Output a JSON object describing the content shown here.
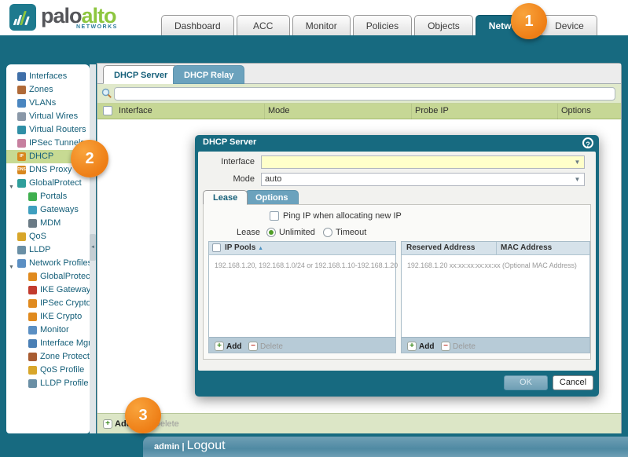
{
  "brand": {
    "word1": "palo",
    "word2": "alto",
    "networks": "NETWORKS"
  },
  "top_tabs": [
    {
      "label": "Dashboard",
      "active": false
    },
    {
      "label": "ACC",
      "active": false
    },
    {
      "label": "Monitor",
      "active": false
    },
    {
      "label": "Policies",
      "active": false
    },
    {
      "label": "Objects",
      "active": false
    },
    {
      "label": "Network",
      "active": true
    },
    {
      "label": "Device",
      "active": false
    }
  ],
  "sidebar": {
    "items": [
      {
        "label": "Interfaces",
        "icon": "interfaces-icon",
        "color": "#3f6fa8",
        "glyph": "",
        "indent": false,
        "expander": false,
        "selected": false
      },
      {
        "label": "Zones",
        "icon": "zones-icon",
        "color": "#b06a38",
        "glyph": "",
        "indent": false,
        "expander": false,
        "selected": false
      },
      {
        "label": "VLANs",
        "icon": "vlans-icon",
        "color": "#4a86c0",
        "glyph": "",
        "indent": false,
        "expander": false,
        "selected": false
      },
      {
        "label": "Virtual Wires",
        "icon": "virtual-wires-icon",
        "color": "#8a98a8",
        "glyph": "",
        "indent": false,
        "expander": false,
        "selected": false
      },
      {
        "label": "Virtual Routers",
        "icon": "virtual-routers-icon",
        "color": "#2f8fa6",
        "glyph": "",
        "indent": false,
        "expander": false,
        "selected": false
      },
      {
        "label": "IPSec Tunnels",
        "icon": "ipsec-tunnels-icon",
        "color": "#c77f9f",
        "glyph": "",
        "indent": false,
        "expander": false,
        "selected": false
      },
      {
        "label": "DHCP",
        "icon": "dhcp-icon",
        "color": "#d8871e",
        "glyph": "IP",
        "indent": false,
        "expander": false,
        "selected": true
      },
      {
        "label": "DNS Proxy",
        "icon": "dns-proxy-icon",
        "color": "#d8871e",
        "glyph": "DNS",
        "indent": false,
        "expander": false,
        "selected": false
      },
      {
        "label": "GlobalProtect",
        "icon": "globalprotect-icon",
        "color": "#2f9e9b",
        "glyph": "",
        "indent": false,
        "expander": true,
        "selected": false
      },
      {
        "label": "Portals",
        "icon": "portals-icon",
        "color": "#3faf4f",
        "glyph": "",
        "indent": true,
        "expander": false,
        "selected": false
      },
      {
        "label": "Gateways",
        "icon": "gateways-icon",
        "color": "#3f9fbf",
        "glyph": "",
        "indent": true,
        "expander": false,
        "selected": false
      },
      {
        "label": "MDM",
        "icon": "mdm-icon",
        "color": "#6a7a85",
        "glyph": "",
        "indent": true,
        "expander": false,
        "selected": false
      },
      {
        "label": "QoS",
        "icon": "qos-icon",
        "color": "#d8a62a",
        "glyph": "",
        "indent": false,
        "expander": false,
        "selected": false
      },
      {
        "label": "LLDP",
        "icon": "lldp-icon",
        "color": "#6a8fa5",
        "glyph": "",
        "indent": false,
        "expander": false,
        "selected": false
      },
      {
        "label": "Network Profiles",
        "icon": "network-profiles-icon",
        "color": "#5b8fc3",
        "glyph": "",
        "indent": false,
        "expander": true,
        "selected": false
      },
      {
        "label": "GlobalProtect IP",
        "icon": "lock-icon",
        "color": "#e08a1e",
        "glyph": "",
        "indent": true,
        "expander": false,
        "selected": false
      },
      {
        "label": "IKE Gateways",
        "icon": "ike-gateways-icon",
        "color": "#c23b2e",
        "glyph": "",
        "indent": true,
        "expander": false,
        "selected": false
      },
      {
        "label": "IPSec Crypto",
        "icon": "lock-icon",
        "color": "#e08a1e",
        "glyph": "",
        "indent": true,
        "expander": false,
        "selected": false
      },
      {
        "label": "IKE Crypto",
        "icon": "lock-icon",
        "color": "#e08a1e",
        "glyph": "",
        "indent": true,
        "expander": false,
        "selected": false
      },
      {
        "label": "Monitor",
        "icon": "monitor-icon",
        "color": "#5b8fc3",
        "glyph": "",
        "indent": true,
        "expander": false,
        "selected": false
      },
      {
        "label": "Interface Mgmt",
        "icon": "interface-mgmt-icon",
        "color": "#4a7fb5",
        "glyph": "",
        "indent": true,
        "expander": false,
        "selected": false
      },
      {
        "label": "Zone Protection",
        "icon": "zone-protection-icon",
        "color": "#a85c32",
        "glyph": "",
        "indent": true,
        "expander": false,
        "selected": false
      },
      {
        "label": "QoS Profile",
        "icon": "qos-profile-icon",
        "color": "#d8a62a",
        "glyph": "",
        "indent": true,
        "expander": false,
        "selected": false
      },
      {
        "label": "LLDP Profile",
        "icon": "lldp-profile-icon",
        "color": "#6a8fa5",
        "glyph": "",
        "indent": true,
        "expander": false,
        "selected": false
      }
    ]
  },
  "main": {
    "tabs": [
      {
        "label": "DHCP Server",
        "active": true
      },
      {
        "label": "DHCP Relay",
        "active": false
      }
    ],
    "search_value": "",
    "columns": [
      "Interface",
      "Mode",
      "Probe IP",
      "Options"
    ],
    "add_label": "Add",
    "delete_label": "Delete"
  },
  "dialog": {
    "title": "DHCP Server",
    "help": "?",
    "interface_label": "Interface",
    "interface_value": "",
    "mode_label": "Mode",
    "mode_value": "auto",
    "tabs": [
      {
        "label": "Lease",
        "active": true
      },
      {
        "label": "Options",
        "active": false
      }
    ],
    "ping_label": "Ping IP when allocating new IP",
    "lease_label": "Lease",
    "lease_options": [
      {
        "label": "Unlimited",
        "selected": true
      },
      {
        "label": "Timeout",
        "selected": false
      }
    ],
    "ip_pools": {
      "header": "IP Pools",
      "sort_arrow": "▲",
      "hint": "192.168.1.20, 192.168.1.0/24 or 192.168.1.10-192.168.1.20",
      "add_label": "Add",
      "delete_label": "Delete"
    },
    "reserved": {
      "col1": "Reserved Address",
      "col2": "MAC Address",
      "hint": "192.168.1.20 xx:xx:xx:xx:xx:xx (Optional MAC Address)",
      "add_label": "Add",
      "delete_label": "Delete"
    },
    "ok_label": "OK",
    "cancel_label": "Cancel"
  },
  "footer": {
    "user": "admin",
    "sep": "|",
    "logout": "Logout"
  },
  "callouts": [
    "1",
    "2",
    "3"
  ],
  "colors": {
    "teal": "#176a80",
    "teal_light": "#2f7e95",
    "callout_orange": "#ee7e16",
    "row_green": "#c6d795",
    "pale_green": "#e0e9cb",
    "tab_blue": "#6ba2bd",
    "selected_green": "#c7da93",
    "field_yellow": "#ffffca"
  }
}
